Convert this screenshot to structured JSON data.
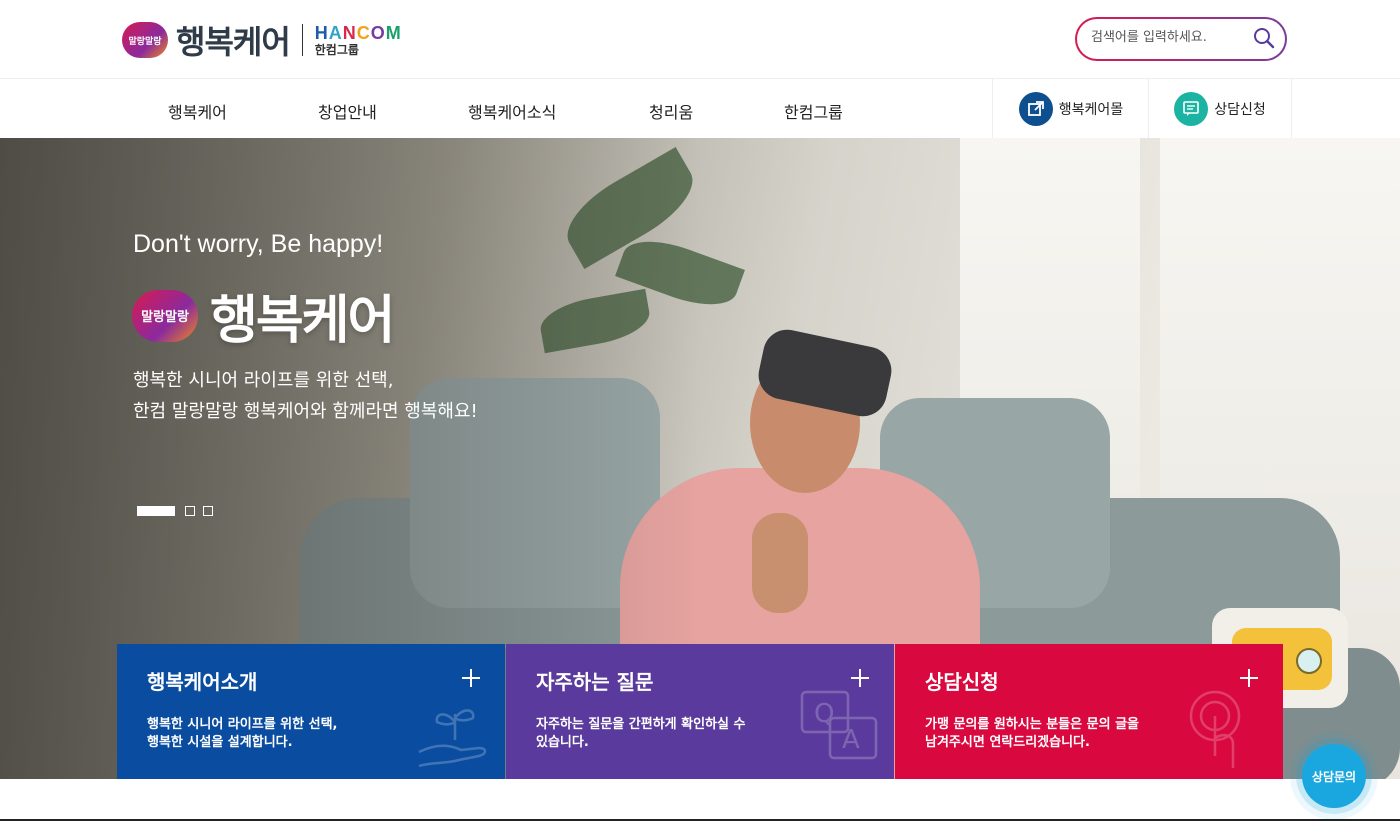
{
  "header": {
    "logo_badge": "말랑말랑",
    "logo_title": "행복케어",
    "group_word": "HANCOM",
    "group_sub": "한컴그룹",
    "search_placeholder": "검색어를 입력하세요."
  },
  "nav": {
    "items": [
      "행복케어",
      "창업안내",
      "행복케어소식",
      "청리움",
      "한컴그룹"
    ],
    "quick": [
      {
        "label": "행복케어몰",
        "icon": "external-link-icon",
        "color": "#0d4f8f"
      },
      {
        "label": "상담신청",
        "icon": "chat-icon",
        "color": "#1bb3a1"
      }
    ]
  },
  "hero": {
    "tagline": "Don't worry, Be happy!",
    "badge": "말랑말랑",
    "title": "행복케어",
    "desc_line1": "행복한 시니어 라이프를 위한 선택,",
    "desc_line2": "한컴 말랑말랑 행복케어와 함께라면 행복해요!",
    "slides_total": 3,
    "active_slide": 1
  },
  "cards": [
    {
      "title": "행복케어소개",
      "desc_line1": "행복한 시니어 라이프를 위한 선택,",
      "desc_line2": "행복한 시설을 설계합니다.",
      "color": "#0a4da0",
      "icon": "plant-hand-icon"
    },
    {
      "title": "자주하는 질문",
      "desc_line1": "자주하는 질문을 간편하게 확인하실 수",
      "desc_line2": "있습니다.",
      "color": "#5a3a9c",
      "icon": "qa-icon"
    },
    {
      "title": "상담신청",
      "desc_line1": "가맹 문의를 원하시는 분들은 문의 글을",
      "desc_line2": "남겨주시면 연락드리겠습니다.",
      "color": "#d9083f",
      "icon": "touch-icon"
    }
  ],
  "floating": {
    "consult_label": "상담문의",
    "color": "#1aa6de"
  }
}
